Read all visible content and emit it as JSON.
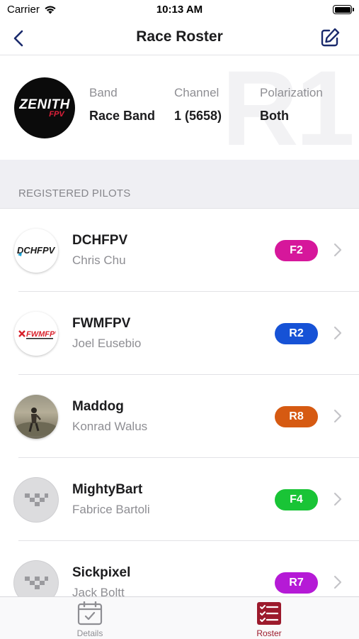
{
  "status_bar": {
    "carrier": "Carrier",
    "time": "10:13 AM"
  },
  "nav": {
    "title": "Race Roster"
  },
  "race": {
    "watermark": "R1",
    "logo_text": "ZENITH",
    "logo_sub": "FPV",
    "band_label": "Band",
    "band_value": "Race Band",
    "channel_label": "Channel",
    "channel_value": "1 (5658)",
    "polarization_label": "Polarization",
    "polarization_value": "Both"
  },
  "section": {
    "title": "REGISTERED PILOTS"
  },
  "pilots": [
    {
      "name": "DCHFPV",
      "real_name": "Chris Chu",
      "badge": "F2",
      "badge_color": "#d6179b",
      "avatar": "logo-dchfpv"
    },
    {
      "name": "FWMFPV",
      "real_name": "Joel Eusebio",
      "badge": "R2",
      "badge_color": "#1652d6",
      "avatar": "logo-fwmfpv"
    },
    {
      "name": "Maddog",
      "real_name": "Konrad Walus",
      "badge": "R8",
      "badge_color": "#d65a12",
      "avatar": "photo"
    },
    {
      "name": "MightyBart",
      "real_name": "Fabrice Bartoli",
      "badge": "F4",
      "badge_color": "#19c436",
      "avatar": "placeholder"
    },
    {
      "name": "Sickpixel",
      "real_name": "Jack Boltt",
      "badge": "R7",
      "badge_color": "#b51ad6",
      "avatar": "placeholder"
    }
  ],
  "tabs": [
    {
      "label": "Details",
      "icon": "calendar-check-icon",
      "active": false,
      "color": "#8e8e93"
    },
    {
      "label": "Roster",
      "icon": "checklist-icon",
      "active": true,
      "color": "#9c1a2c"
    }
  ]
}
